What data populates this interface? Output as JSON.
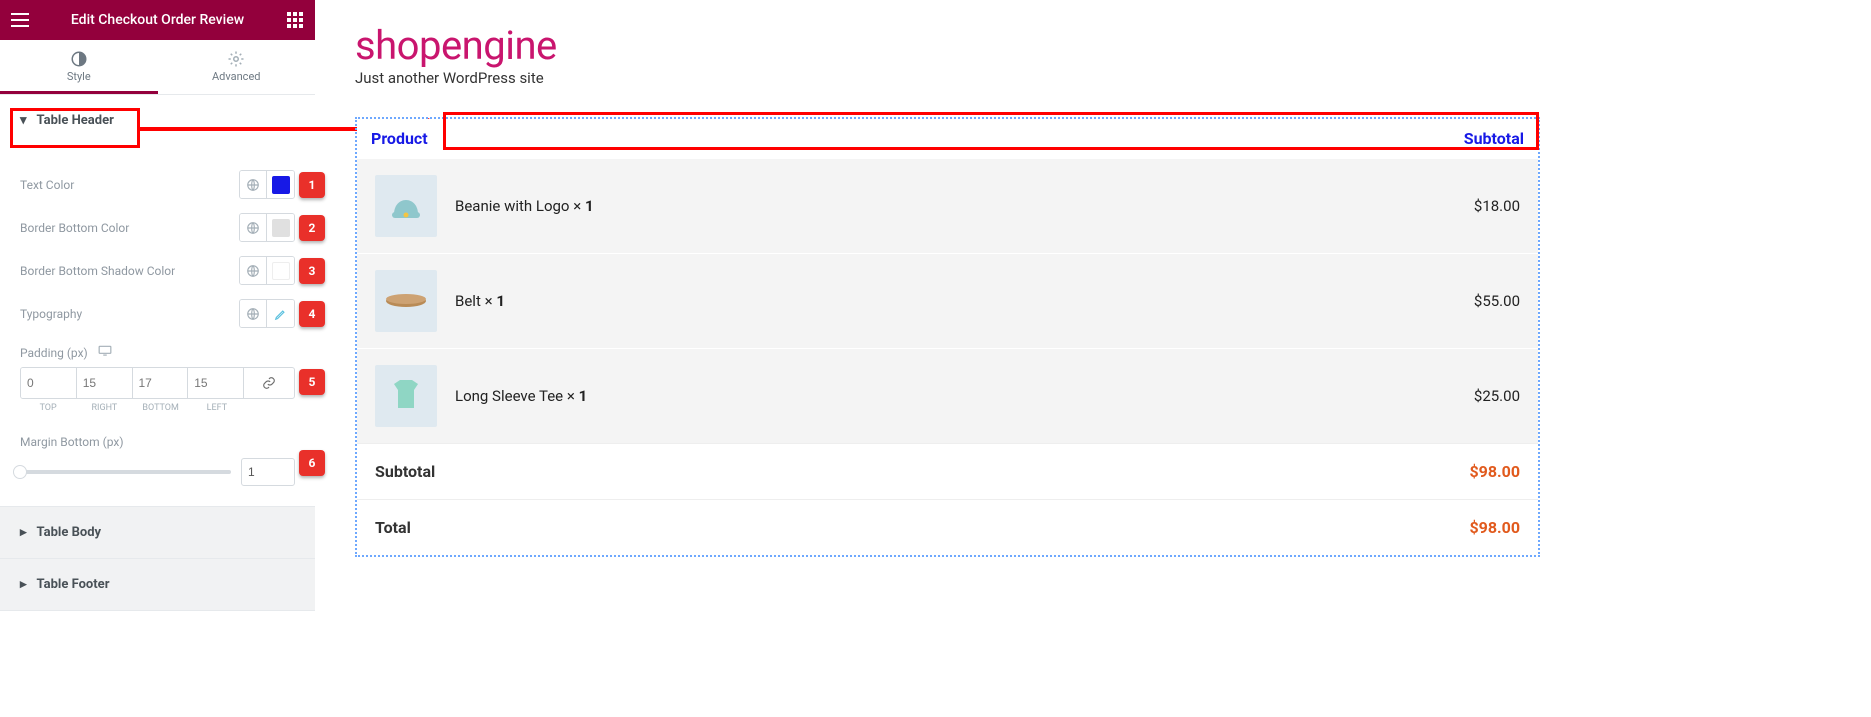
{
  "topbar": {
    "title": "Edit Checkout Order Review"
  },
  "tabs": {
    "style": "Style",
    "advanced": "Advanced"
  },
  "sections": {
    "header": "Table Header",
    "body": "Table Body",
    "footer": "Table Footer"
  },
  "controls": {
    "text_color": {
      "label": "Text Color",
      "value": "#1719e6"
    },
    "border_bottom_color": {
      "label": "Border Bottom Color",
      "value": "#e0e0e0"
    },
    "border_bottom_shadow_color": {
      "label": "Border Bottom Shadow Color",
      "value": "#ffffff"
    },
    "typography": {
      "label": "Typography"
    },
    "padding": {
      "label": "Padding (px)",
      "top": "0",
      "right": "15",
      "bottom": "17",
      "left": "15",
      "lbl_top": "TOP",
      "lbl_right": "RIGHT",
      "lbl_bottom": "BOTTOM",
      "lbl_left": "LEFT"
    },
    "margin_bottom": {
      "label": "Margin Bottom (px)",
      "value": "1"
    }
  },
  "badges": {
    "b1": "1",
    "b2": "2",
    "b3": "3",
    "b4": "4",
    "b5": "5",
    "b6": "6"
  },
  "site": {
    "title": "shopengine",
    "tagline": "Just another WordPress site"
  },
  "order": {
    "head_product": "Product",
    "head_subtotal": "Subtotal",
    "items": [
      {
        "name": "Beanie with Logo",
        "qty": "1",
        "price": "$18.00"
      },
      {
        "name": "Belt",
        "qty": "1",
        "price": "$55.00"
      },
      {
        "name": "Long Sleeve Tee",
        "qty": "1",
        "price": "$25.00"
      }
    ],
    "subtotal_label": "Subtotal",
    "subtotal_value": "$98.00",
    "total_label": "Total",
    "total_value": "$98.00",
    "qty_sep": " × "
  },
  "thumb_colors": {
    "beanie": "#8fc7cc",
    "belt": "#b98b56",
    "tee": "#8fd6c4"
  }
}
